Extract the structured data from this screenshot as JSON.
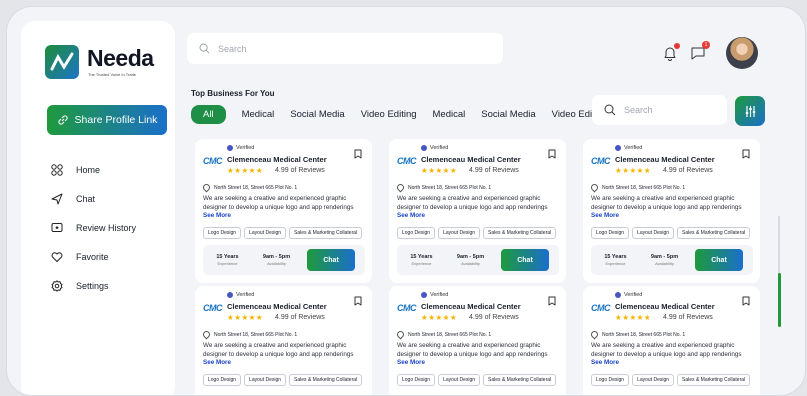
{
  "brand": {
    "name": "Needa",
    "tagline": "The Trusted Voice In Trade"
  },
  "sidebar": {
    "share_label": "Share Profile Link",
    "items": [
      {
        "label": "Home",
        "icon": "grid-icon"
      },
      {
        "label": "Chat",
        "icon": "send-icon"
      },
      {
        "label": "Review History",
        "icon": "review-icon"
      },
      {
        "label": "Favorite",
        "icon": "heart-icon"
      },
      {
        "label": "Settings",
        "icon": "gear-icon"
      }
    ]
  },
  "header": {
    "search_placeholder": "Search",
    "notification_badge": "1"
  },
  "section": {
    "title": "Top Business For You",
    "chips": [
      "All",
      "Medical",
      "Social Media",
      "Video Editing",
      "Medical",
      "Social Media",
      "Video Editing"
    ],
    "search_placeholder": "Search"
  },
  "card": {
    "logo": "CMC",
    "verified": "Verified",
    "name": "Clemenceau Medical Center",
    "stars": "★★★★★",
    "rating": "4.99 of Reviews",
    "address": "North Street 18, Street 665 Plot No. 1",
    "description": "We are seeking a creative and experienced graphic designer to develop a unique logo and app renderings",
    "see_more": "See More",
    "tags": [
      "Logo Design",
      "Layout Design",
      "Sales & Marketing Collateral"
    ],
    "experience_value": "15 Years",
    "experience_label": "Experience",
    "availability_value": "9am - 5pm",
    "availability_label": "Availability",
    "chat_label": "Chat"
  },
  "colors": {
    "accent_green": "#1e9a3d",
    "accent_blue": "#1b6fcb",
    "star": "#f4b400"
  }
}
